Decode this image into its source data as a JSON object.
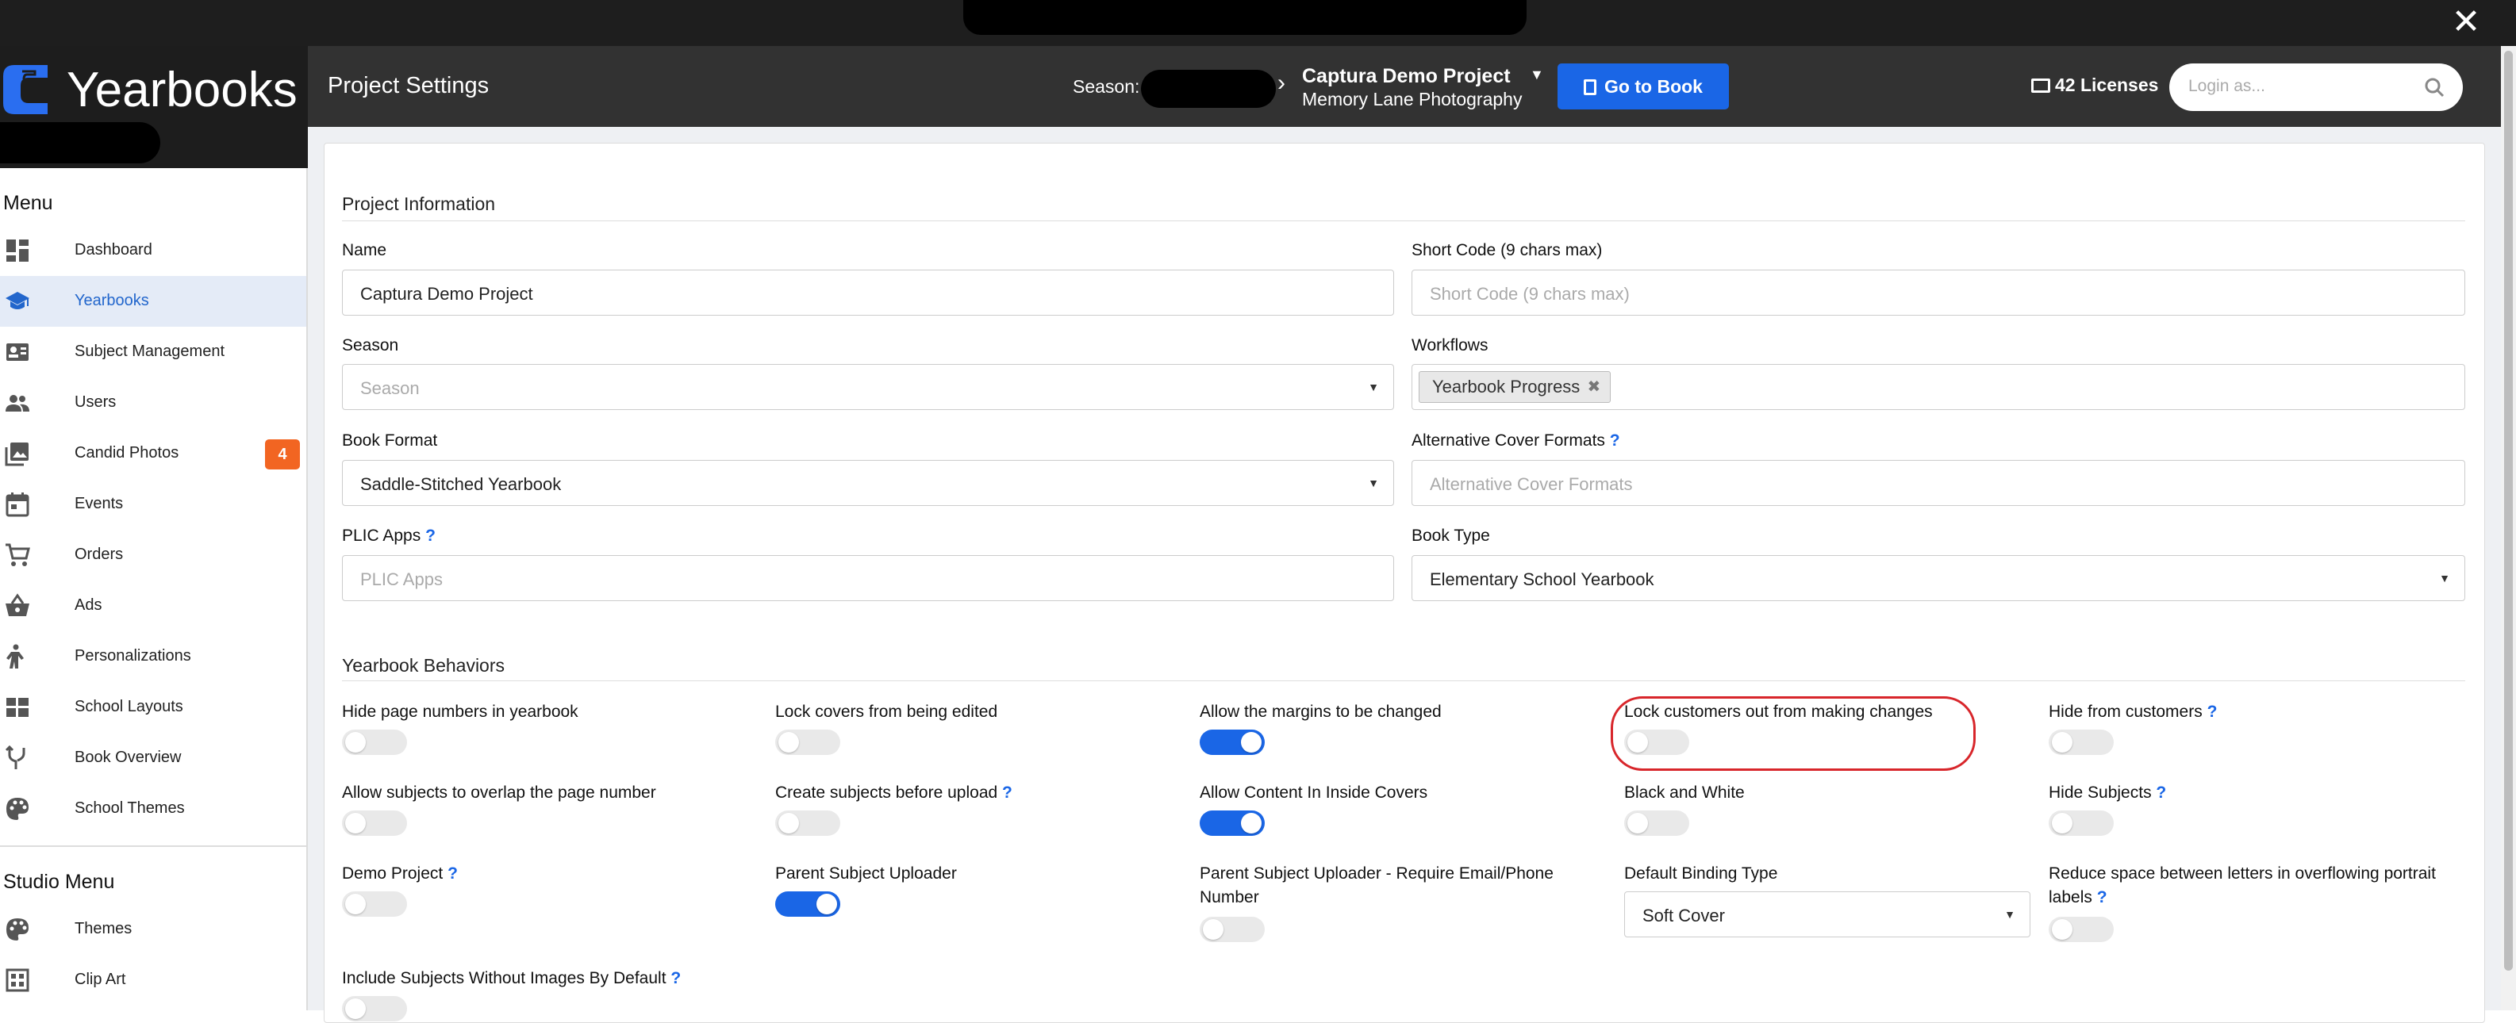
{
  "window": {
    "close_label": "✕"
  },
  "brand": {
    "name": "Yearbooks"
  },
  "sidebar": {
    "menu_title": "Menu",
    "items": [
      {
        "label": "Dashboard",
        "icon": "dashboard-icon"
      },
      {
        "label": "Yearbooks",
        "icon": "graduation-cap-icon",
        "active": true
      },
      {
        "label": "Subject Management",
        "icon": "id-card-icon"
      },
      {
        "label": "Users",
        "icon": "users-icon"
      },
      {
        "label": "Candid Photos",
        "icon": "photos-icon",
        "badge": "4"
      },
      {
        "label": "Events",
        "icon": "calendar-icon"
      },
      {
        "label": "Orders",
        "icon": "cart-icon"
      },
      {
        "label": "Ads",
        "icon": "basket-icon"
      },
      {
        "label": "Personalizations",
        "icon": "person-icon"
      },
      {
        "label": "School Layouts",
        "icon": "layout-icon"
      },
      {
        "label": "Book Overview",
        "icon": "branch-icon"
      },
      {
        "label": "School Themes",
        "icon": "palette-icon"
      }
    ],
    "studio_title": "Studio Menu",
    "studio_items": [
      {
        "label": "Themes",
        "icon": "palette-icon"
      },
      {
        "label": "Clip Art",
        "icon": "clip-art-icon"
      }
    ]
  },
  "header": {
    "title": "Project Settings",
    "season_label": "Season:",
    "project_name": "Captura Demo Project",
    "project_sub": "Memory Lane Photography",
    "goto_label": "Go to Book",
    "licenses": "42 Licenses",
    "login_placeholder": "Login as..."
  },
  "project_info": {
    "title": "Project Information",
    "name_label": "Name",
    "name_value": "Captura Demo Project",
    "short_code_label": "Short Code (9 chars max)",
    "short_code_placeholder": "Short Code (9 chars max)",
    "season_label": "Season",
    "season_placeholder": "Season",
    "workflows_label": "Workflows",
    "workflow_chip": "Yearbook Progress",
    "book_format_label": "Book Format",
    "book_format_value": "Saddle-Stitched Yearbook",
    "alt_cover_label": "Alternative Cover Formats",
    "alt_cover_placeholder": "Alternative Cover Formats",
    "plic_label": "PLIC Apps",
    "plic_placeholder": "PLIC Apps",
    "book_type_label": "Book Type",
    "book_type_value": "Elementary School Yearbook",
    "help_mark": "?"
  },
  "behaviors": {
    "title": "Yearbook Behaviors",
    "hide_page_numbers": "Hide page numbers in yearbook",
    "lock_covers": "Lock covers from being edited",
    "allow_margins": "Allow the margins to be changed",
    "lock_customers": "Lock customers out from making changes",
    "hide_from_customers": "Hide from customers",
    "allow_overlap": "Allow subjects to overlap the page number",
    "create_subjects": "Create subjects before upload",
    "allow_inside_covers": "Allow Content In Inside Covers",
    "black_white": "Black and White",
    "hide_subjects": "Hide Subjects",
    "demo_project": "Demo Project",
    "parent_uploader": "Parent Subject Uploader",
    "parent_uploader_require": "Parent Subject Uploader - Require Email/Phone Number",
    "binding_label": "Default Binding Type",
    "binding_value": "Soft Cover",
    "reduce_space": "Reduce space between letters in overflowing portrait labels",
    "include_subjects": "Include Subjects Without Images By Default"
  },
  "toggle_states": {
    "hide_page_numbers": false,
    "lock_covers": false,
    "allow_margins": true,
    "lock_customers": false,
    "hide_from_customers": false,
    "allow_overlap": false,
    "create_subjects": false,
    "allow_inside_covers": true,
    "black_white": false,
    "hide_subjects": false,
    "demo_project": false,
    "parent_uploader": true,
    "parent_uploader_require": false,
    "reduce_space": false,
    "include_subjects": false
  },
  "colors": {
    "accent": "#1a66e6",
    "badge": "#f26522",
    "header": "#323232",
    "highlight": "#d8262b"
  }
}
